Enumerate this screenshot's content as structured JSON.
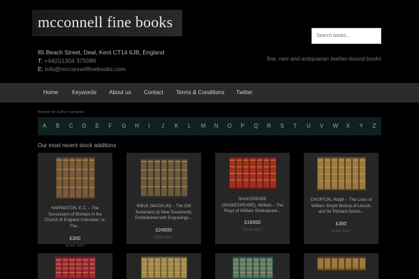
{
  "header": {
    "logo": "mcconnell fine books",
    "address": "85 Beach Street, Deal, Kent CT14 6JB, England",
    "phone_label": "T:",
    "phone": "+44(0)1304 375086",
    "email_label": "E:",
    "email": "info@mcconnellfinebooks.com",
    "search_placeholder": "Search books...",
    "tagline": "fine, rare and antiquarian leather-bound books"
  },
  "nav": [
    "Home",
    "Keywords",
    "About us",
    "Contact",
    "Terms & Conditions",
    "Twitter"
  ],
  "browse": {
    "label": "Browse by author surname:",
    "letters": [
      "A",
      "B",
      "C",
      "D",
      "E",
      "F",
      "G",
      "H",
      "I",
      "J",
      "K",
      "L",
      "M",
      "N",
      "O",
      "P",
      "Q",
      "R",
      "S",
      "T",
      "U",
      "V",
      "W",
      "X",
      "Y",
      "Z"
    ]
  },
  "section_title": "Our most recent stock additions",
  "products": [
    {
      "title": "HARINGTON, E.C. – The Succession of Bishops in the Church of England Unbroken; or, The...",
      "price": "£300",
      "more": "MORE INFO",
      "colors": [
        "#4a3a28",
        "#7a5a3a"
      ]
    },
    {
      "title": "BIBLE (MACKLIN) – The Old Testament (& New Testament). Embellished with Engravings...",
      "price": "£24000",
      "more": "MORE INFO",
      "colors": [
        "#3a3025",
        "#6a5a40"
      ]
    },
    {
      "title": "SHAKSPEARE (SHAKESPEARE), William – The Plays of William Shakspeare...",
      "price": "£16000",
      "more": "MORE INFO",
      "colors": [
        "#6a1a12",
        "#a03020"
      ]
    },
    {
      "title": "CHURTON, Ralph – The Lives of William Smyth Bishop of Lincoln and Sir Richard Sutton...",
      "price": "£350",
      "more": "MORE INFO",
      "colors": [
        "#5a4220",
        "#9a7a40"
      ]
    }
  ],
  "products_row2": [
    {
      "colors": [
        "#7a1a2a",
        "#a02a3a"
      ]
    },
    {
      "colors": [
        "#6a5a30",
        "#a08a50"
      ]
    },
    {
      "colors": [
        "#2a4a4a",
        "#5a7a6a"
      ]
    },
    {
      "colors": [
        "#5a3a1a",
        "#8a6a3a"
      ]
    }
  ]
}
